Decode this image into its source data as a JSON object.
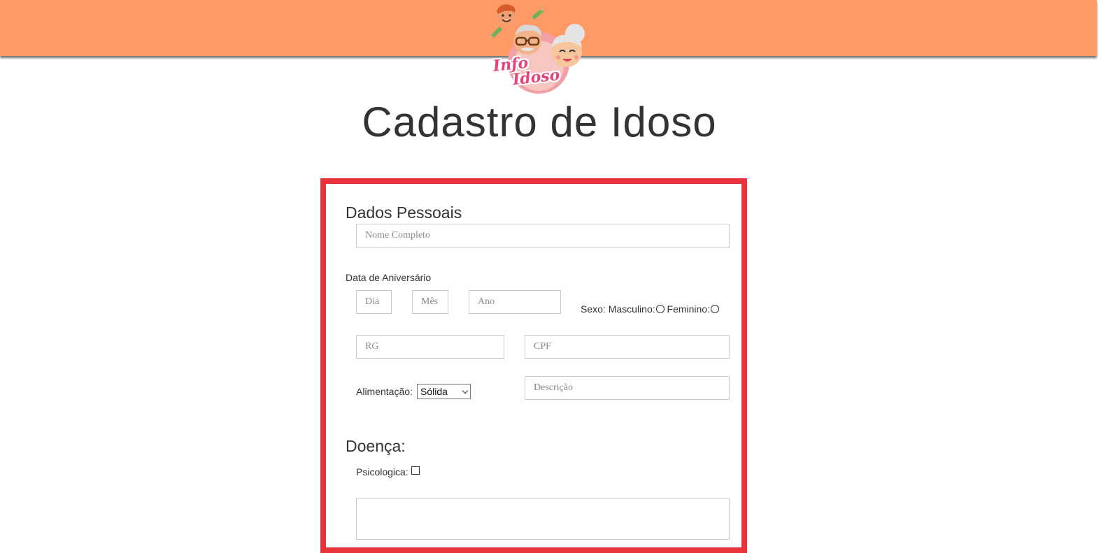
{
  "header": {
    "accent_color": "#ff9966",
    "logo": {
      "line1": "Info",
      "line2": "Idoso"
    }
  },
  "page_title": "Cadastro de Idoso",
  "form": {
    "border_color": "#e8333c",
    "dados_pessoais": {
      "title": "Dados Pessoais",
      "nome_placeholder": "Nome Completo",
      "aniversario_label": "Data de Aniversário",
      "dia_placeholder": "Dia",
      "mes_placeholder": "Mês",
      "ano_placeholder": "Ano",
      "sexo_label": "Sexo:",
      "masculino_label": "Masculino:",
      "feminino_label": "Feminino:",
      "rg_placeholder": "RG",
      "cpf_placeholder": "CPF",
      "alimentacao_label": "Alimentação:",
      "alimentacao_value": "Sólida",
      "descricao_placeholder": "Descrição"
    },
    "doenca": {
      "title": "Doença:",
      "psicologica_label": "Psicologica:"
    }
  }
}
